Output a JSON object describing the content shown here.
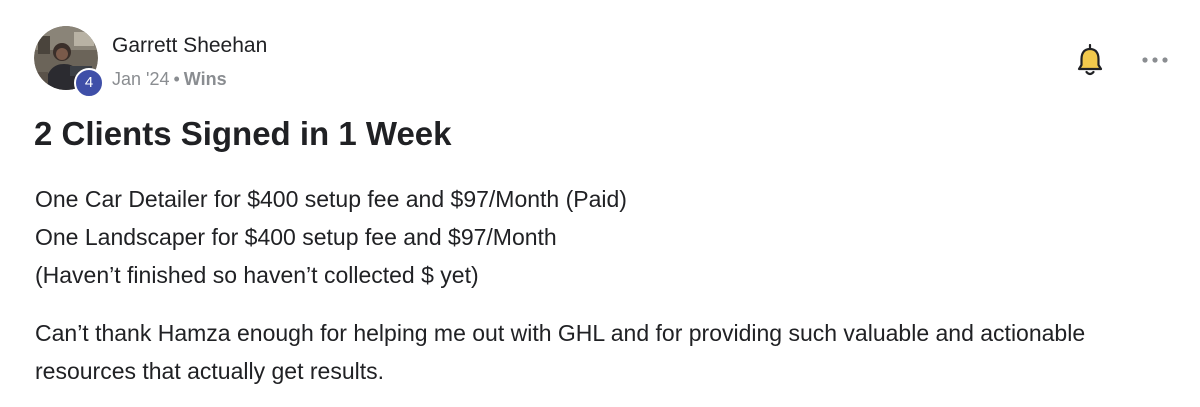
{
  "post": {
    "author": {
      "name": "Garrett Sheehan",
      "level": "4",
      "avatar_icon": "avatar-photo"
    },
    "meta": {
      "date": "Jan '24",
      "separator": "•",
      "category": "Wins"
    },
    "actions": {
      "bell_icon": "bell-icon",
      "more_icon": "more-options-icon"
    },
    "title": "2 Clients Signed in 1 Week",
    "body": {
      "lines": [
        "One Car Detailer for $400 setup fee and $97/Month (Paid)",
        "One Landscaper for $400 setup fee and $97/Month",
        "(Haven’t finished so haven’t collected $ yet)"
      ],
      "paragraph2": "Can’t thank Hamza enough for helping me out with GHL and for providing such valuable and actionable resources that actually get results."
    }
  },
  "colors": {
    "badge": "#3f4fa8",
    "bell": "#f2c94c",
    "meta_text": "#8a8d91",
    "text": "#202124"
  }
}
